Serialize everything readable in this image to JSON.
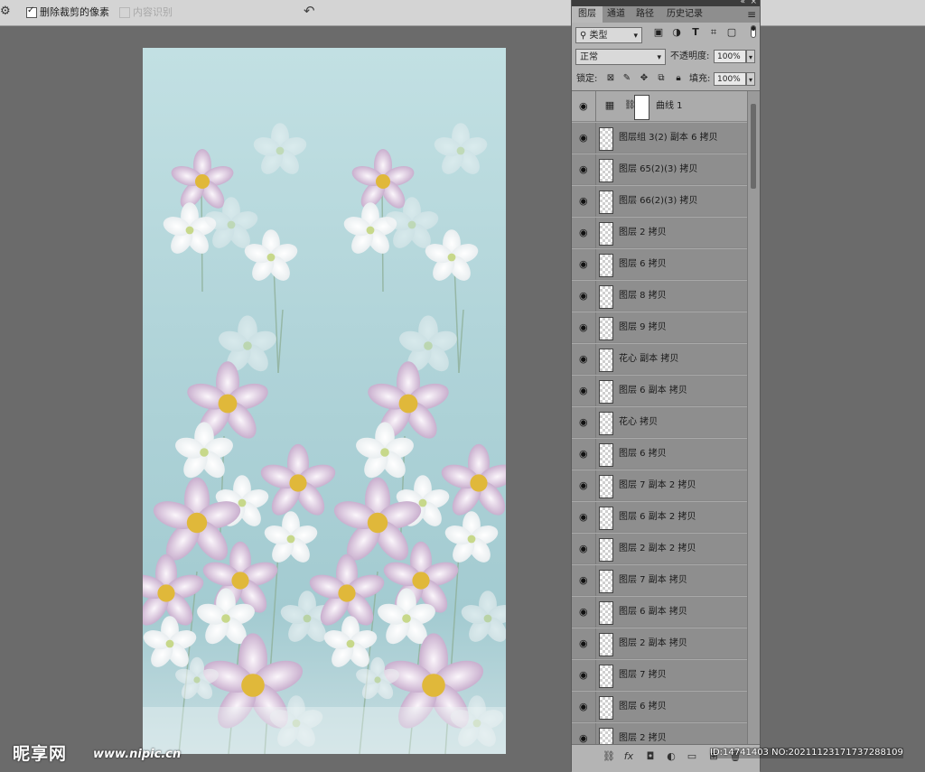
{
  "options_bar": {
    "tool_icon": "gear-icon",
    "delete_cropped_label": "删除裁剪的像素",
    "delete_cropped_checked": true,
    "content_aware_label": "内容识别",
    "content_aware_checked": false,
    "content_aware_enabled": false,
    "reset_icon": "undo-icon"
  },
  "panel": {
    "collapse_icon": "double-chevron-icon",
    "close_icon": "close-icon",
    "tabs": [
      "图层",
      "通道",
      "路径",
      "历史记录"
    ],
    "active_tab": "图层",
    "menu_icon": "hamburger-icon",
    "filter": {
      "kind_label": "类型",
      "icons": [
        "image-filter-icon",
        "adjustment-filter-icon",
        "type-filter-icon",
        "shape-filter-icon",
        "smart-object-filter-icon"
      ]
    },
    "blend_mode": "正常",
    "opacity_label": "不透明度:",
    "opacity_value": "100%",
    "lock_label": "锁定:",
    "fill_label": "填充:",
    "fill_value": "100%",
    "lock_icons": [
      "lock-transparency-icon",
      "lock-brush-icon",
      "lock-move-icon",
      "lock-artboard-icon",
      "lock-all-icon"
    ],
    "layers": [
      {
        "name": "曲线 1",
        "type": "adjustment",
        "visible": true
      },
      {
        "name": "图层组 3(2) 副本 6 拷贝",
        "visible": true
      },
      {
        "name": "图层 65(2)(3) 拷贝",
        "visible": true
      },
      {
        "name": "图层 66(2)(3) 拷贝",
        "visible": true
      },
      {
        "name": "图层 2 拷贝",
        "visible": true
      },
      {
        "name": "图层 6 拷贝",
        "visible": true
      },
      {
        "name": "图层 8 拷贝",
        "visible": true
      },
      {
        "name": "图层 9 拷贝",
        "visible": true
      },
      {
        "name": "花心 副本 拷贝",
        "visible": true
      },
      {
        "name": "图层 6 副本 拷贝",
        "visible": true
      },
      {
        "name": "花心 拷贝",
        "visible": true
      },
      {
        "name": "图层 6 拷贝",
        "visible": true
      },
      {
        "name": "图层 7 副本 2 拷贝",
        "visible": true
      },
      {
        "name": "图层 6 副本 2 拷贝",
        "visible": true
      },
      {
        "name": "图层 2 副本 2 拷贝",
        "visible": true
      },
      {
        "name": "图层 7 副本 拷贝",
        "visible": true
      },
      {
        "name": "图层 6 副本 拷贝",
        "visible": true
      },
      {
        "name": "图层 2 副本 拷贝",
        "visible": true
      },
      {
        "name": "图层 7 拷贝",
        "visible": true
      },
      {
        "name": "图层 6 拷贝",
        "visible": true
      },
      {
        "name": "图层 2 拷贝",
        "visible": true
      }
    ],
    "bottom_icons": [
      "link-layers-icon",
      "fx-icon",
      "add-mask-icon",
      "new-adjustment-icon",
      "new-group-icon",
      "new-layer-icon",
      "delete-layer-icon"
    ]
  },
  "watermark": {
    "logo": "昵享网",
    "site": "www.nipic.cn",
    "id_text": "ID:14741403 NO:20211123171737288109"
  }
}
